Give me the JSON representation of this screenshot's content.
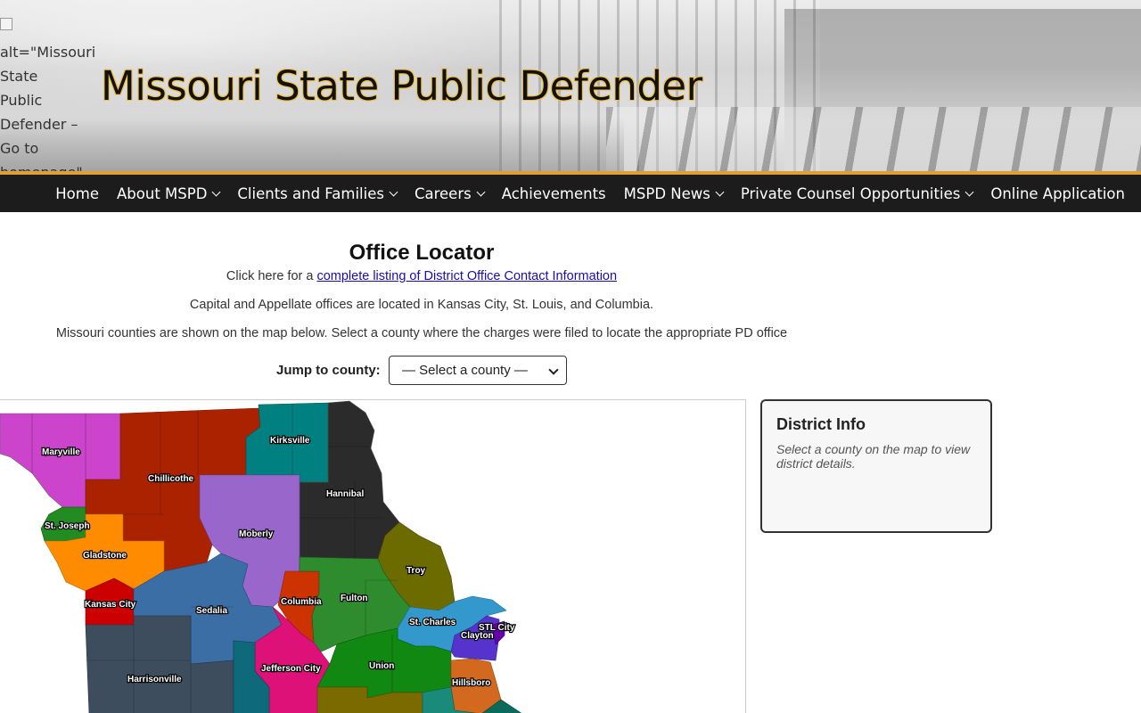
{
  "header": {
    "logo_alt": "alt=\"Missouri State Public Defender – Go to homepage\"",
    "site_title": "Missouri State Public Defender"
  },
  "nav": {
    "items": [
      {
        "label": "Home",
        "has_dropdown": false
      },
      {
        "label": "About MSPD",
        "has_dropdown": true
      },
      {
        "label": "Clients and Families",
        "has_dropdown": true
      },
      {
        "label": "Careers",
        "has_dropdown": true
      },
      {
        "label": "Achievements",
        "has_dropdown": false
      },
      {
        "label": "MSPD News",
        "has_dropdown": true
      },
      {
        "label": "Private Counsel Opportunities",
        "has_dropdown": true
      },
      {
        "label": "Online Application",
        "has_dropdown": false
      }
    ]
  },
  "main": {
    "title": "Office Locator",
    "line1_prefix": "Click here for a ",
    "line1_link": "complete listing of District Office Contact Information",
    "line2": "Capital and Appellate offices are located in Kansas City, St. Louis, and Columbia.",
    "line3": "Missouri counties are shown on the map below. Select a county where the charges were filed to locate the appropriate PD office",
    "jump_label": "Jump to county:",
    "county_select_value": "— Select a county —"
  },
  "district_info": {
    "title": "District Info",
    "message": "Select a county on the map to view district details."
  },
  "map": {
    "district_labels": [
      "Maryville",
      "Chillicothe",
      "Kirksville",
      "Hannibal",
      "St. Joseph",
      "Moberly",
      "Gladstone",
      "Troy",
      "Kansas City",
      "Sedalia",
      "Columbia",
      "Fulton",
      "St. Charles",
      "STL City",
      "Clayton",
      "Jefferson City",
      "Union",
      "Harrisonville",
      "Hillsboro"
    ],
    "colors": {
      "maryville": "#cc44cc",
      "chillicothe": "#aa2200",
      "kirksville": "#008080",
      "hannibal": "#2b2b2b",
      "st_joseph": "#228b22",
      "moberly": "#9966cc",
      "gladstone": "#ff8c00",
      "troy": "#6b6b00",
      "kansas_city": "#cc0000",
      "sedalia": "#3b6ea5",
      "columbia": "#cc3300",
      "fulton": "#2e8b2e",
      "st_charles": "#3399cc",
      "stl_city": "#6600aa",
      "clayton": "#5533cc",
      "jefferson_city": "#dd1177",
      "union": "#118811",
      "harrisonville": "#3d4d5d",
      "hillsboro": "#d2691e"
    }
  }
}
